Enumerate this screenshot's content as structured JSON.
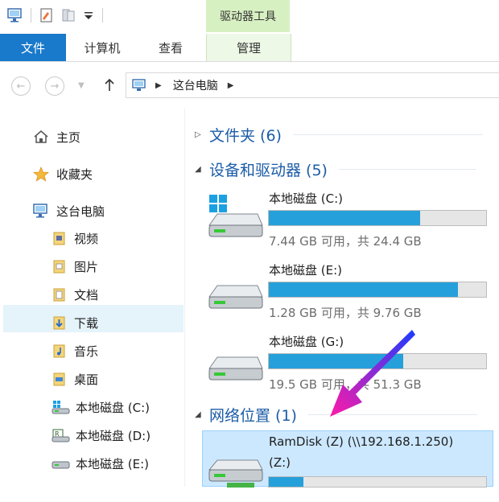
{
  "ribbon": {
    "context_tab": "驱动器工具",
    "tabs": [
      "文件",
      "计算机",
      "查看",
      "管理"
    ]
  },
  "address": {
    "path": [
      "这台电脑"
    ]
  },
  "nav": {
    "home": "主页",
    "favorites": "收藏夹",
    "this_pc": "这台电脑",
    "items": [
      "视频",
      "图片",
      "文档",
      "下载",
      "音乐",
      "桌面",
      "本地磁盘 (C:)",
      "本地磁盘 (D:)",
      "本地磁盘 (E:)"
    ]
  },
  "groups": {
    "folders": "文件夹 (6)",
    "devices": "设备和驱动器 (5)",
    "network": "网络位置 (1)"
  },
  "drives": [
    {
      "name": "本地磁盘 (C:)",
      "size": "7.44 GB 可用，共 24.4 GB",
      "used_fraction": 0.695,
      "icon": "windows-drive-icon"
    },
    {
      "name": "本地磁盘 (E:)",
      "size": "1.28 GB 可用，共 9.76 GB",
      "used_fraction": 0.869,
      "icon": "drive-icon"
    },
    {
      "name": "本地磁盘 (G:)",
      "size": "19.5 GB 可用，共 51.3 GB",
      "used_fraction": 0.62,
      "icon": "drive-icon"
    }
  ],
  "network_drive": {
    "name_line1": "RamDisk (Z) (\\\\192.168.1.250)",
    "name_line2": "(Z:)",
    "used_fraction": 0.16
  },
  "colors": {
    "accent": "#1979ca",
    "bar_fill": "#26a0da",
    "context_tab": "#d7f0c2",
    "group_label": "#1c5ca8",
    "arrow_start": "#1a3cff",
    "arrow_end": "#ff1aa8"
  }
}
